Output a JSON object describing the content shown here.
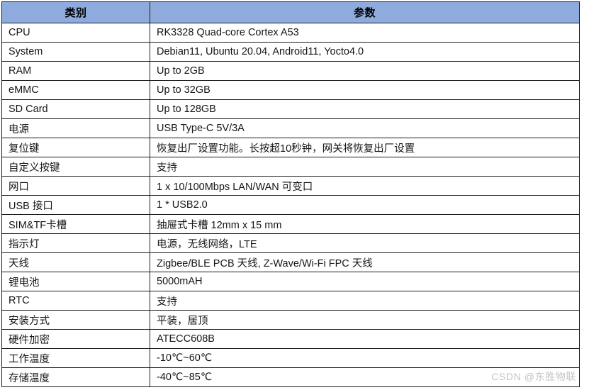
{
  "table": {
    "headers": {
      "category": "类别",
      "parameter": "参数"
    },
    "rows": [
      {
        "category": "CPU",
        "parameter": "RK3328 Quad-core Cortex A53"
      },
      {
        "category": "System",
        "parameter": "Debian11, Ubuntu 20.04, Android11, Yocto4.0"
      },
      {
        "category": "RAM",
        "parameter": "Up to 2GB"
      },
      {
        "category": "eMMC",
        "parameter": "Up to 32GB"
      },
      {
        "category": "SD Card",
        "parameter": "Up to 128GB"
      },
      {
        "category": "电源",
        "parameter": "USB Type-C 5V/3A"
      },
      {
        "category": "复位键",
        "parameter": "恢复出厂设置功能。长按超10秒钟，网关将恢复出厂设置"
      },
      {
        "category": "自定义按键",
        "parameter": "支持"
      },
      {
        "category": "网口",
        "parameter": "1 x 10/100Mbps LAN/WAN 可变口"
      },
      {
        "category": "USB 接口",
        "parameter": "1 * USB2.0"
      },
      {
        "category": "SIM&TF卡槽",
        "parameter": "抽屉式卡槽 12mm x 15 mm"
      },
      {
        "category": "指示灯",
        "parameter": "电源，无线网络，LTE"
      },
      {
        "category": "天线",
        "parameter": "Zigbee/BLE PCB 天线, Z-Wave/Wi-Fi FPC 天线"
      },
      {
        "category": "锂电池",
        "parameter": "5000mAH"
      },
      {
        "category": "RTC",
        "parameter": "支持"
      },
      {
        "category": "安装方式",
        "parameter": "平装，居顶"
      },
      {
        "category": "硬件加密",
        "parameter": "ATECC608B"
      },
      {
        "category": "工作温度",
        "parameter": "-10℃~60℃"
      },
      {
        "category": "存储温度",
        "parameter": "-40℃~85℃"
      }
    ]
  },
  "watermark": {
    "text": "CSDN @东胜物联"
  },
  "colors": {
    "header_fill": "#8faadc",
    "border": "#1c1c1c",
    "text": "#161616",
    "watermark_text": "#c3c3c3",
    "background": "#ffffff"
  }
}
